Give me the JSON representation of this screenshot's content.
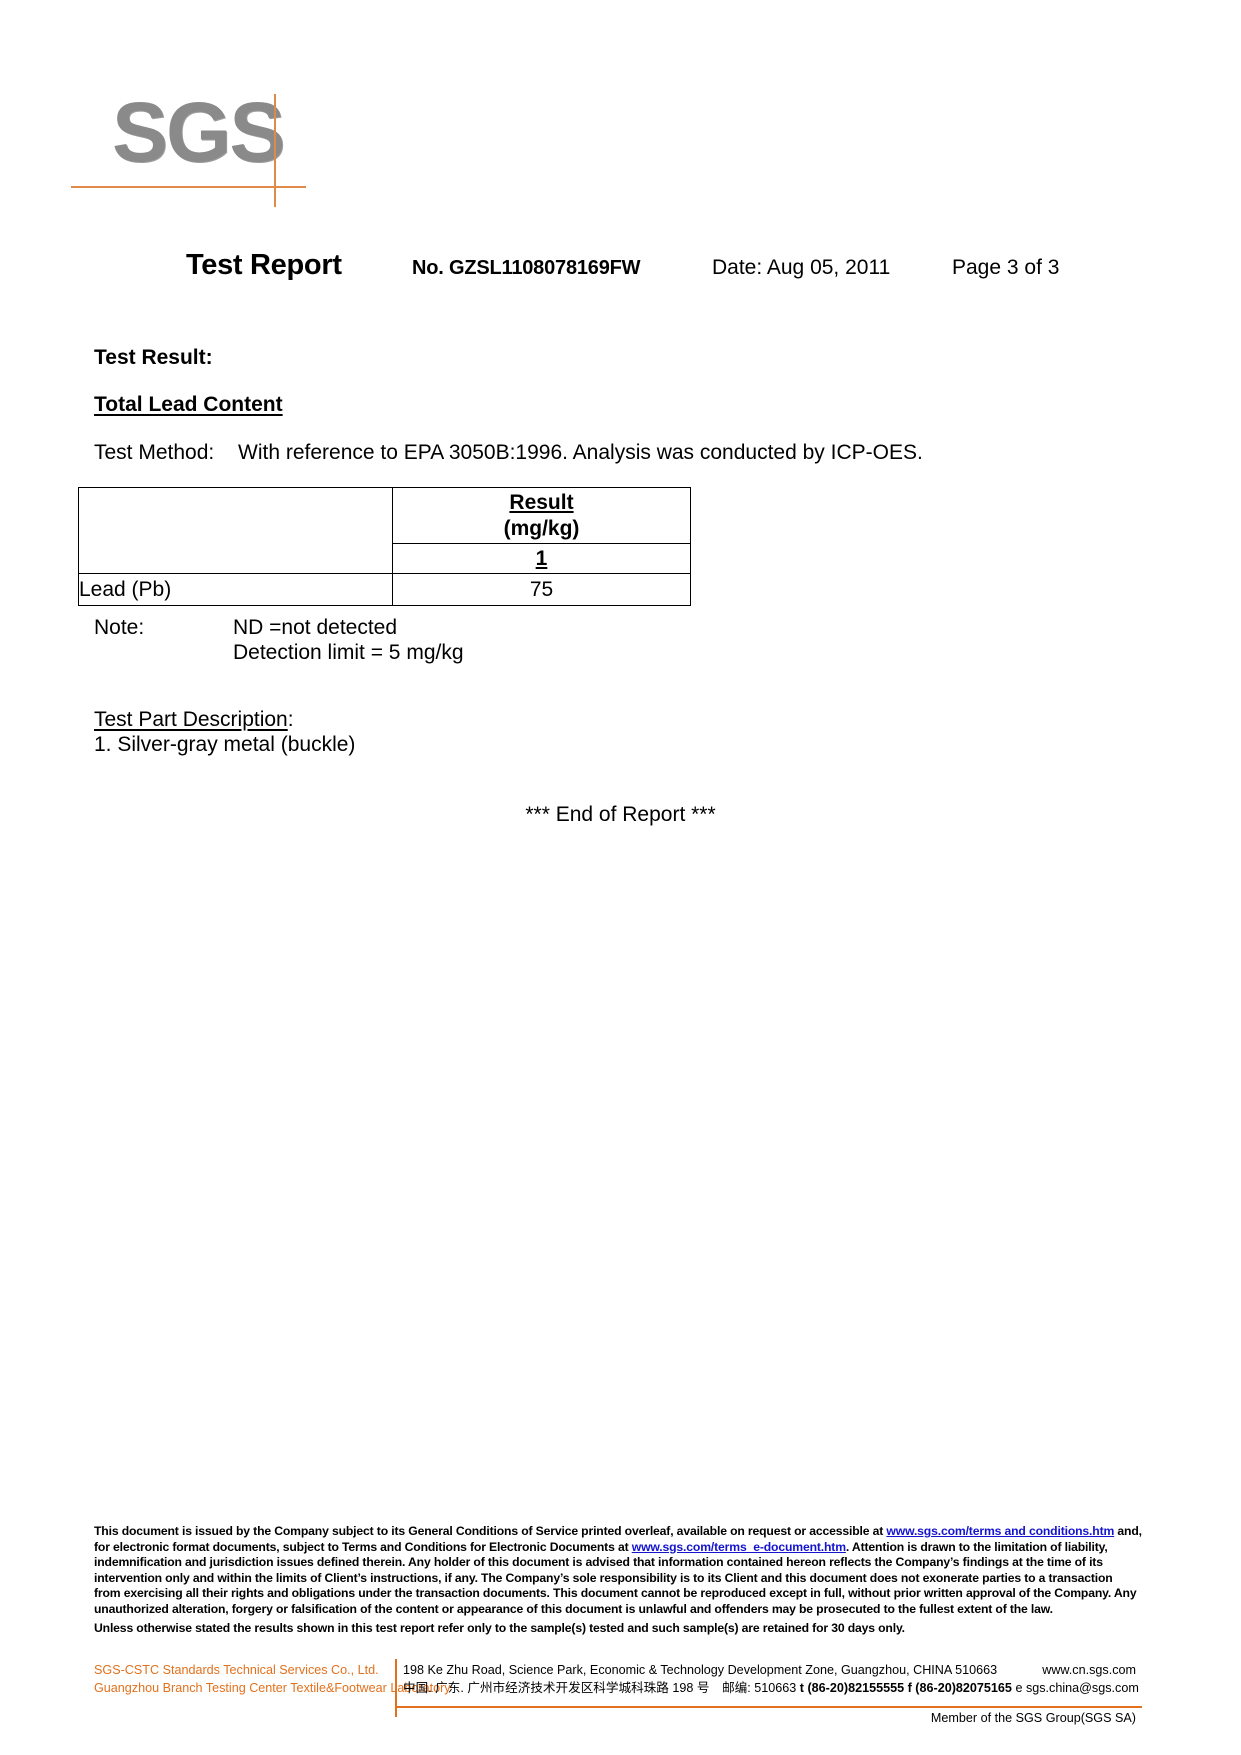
{
  "logo": {
    "text": "SGS",
    "accent_color": "#e08a4a",
    "text_color": "#8a8a8a"
  },
  "header": {
    "title": "Test Report",
    "report_no": "No. GZSL1108078169FW",
    "date": "Date: Aug 05, 2011",
    "page": "Page 3 of 3"
  },
  "body": {
    "test_result_heading": "Test Result:",
    "section_heading": "Total Lead Content",
    "test_method_label": "Test Method:",
    "test_method_value": "With reference to EPA 3050B:1996. Analysis was conducted by ICP-OES.",
    "note_label": "Note:",
    "note_line_1": "ND =not detected",
    "note_line_2": "Detection limit = 5 mg/kg",
    "tpd_heading_underlined": "Test Part Description",
    "tpd_heading_colon": ":",
    "tpd_item_1": "1. Silver-gray metal (buckle)",
    "end_of_report": "*** End of Report ***"
  },
  "results_table": {
    "header_blank": "",
    "header_result_line1": "Result",
    "header_result_line2": "(mg/kg)",
    "sub_blank": "",
    "sub_index": "1",
    "rows": [
      {
        "label": "Lead (Pb)",
        "value": "75"
      }
    ]
  },
  "footer": {
    "legal_p1_a": "This document is issued by the Company subject to its General Conditions of  Service printed overleaf, available on request or accessible at ",
    "legal_link_1": "www.sgs.com/terms and conditions.htm",
    "legal_p1_b": " and, for electronic format documents, subject to Terms and Conditions for Electronic Documents at ",
    "legal_link_2": "www.sgs.com/terms_e-document.htm",
    "legal_p1_c": ". Attention is drawn to the limitation of liability, indemnification and jurisdiction issues defined therein. Any holder of this document is advised that information contained hereon reflects the Company’s findings at the time of its intervention only and within the limits of Client’s instructions, if any. The Company’s sole responsibility is to its Client and this document does not exonerate parties to a transaction from exercising all their rights and obligations under the transaction documents. This document cannot be reproduced except in full, without prior written approval of the Company. Any unauthorized alteration, forgery or falsification of the content or appearance of this document is unlawful and offenders may be prosecuted to the fullest extent of the law.",
    "legal_p2": "Unless otherwise stated the results shown in this test report refer only to the sample(s) tested and such sample(s) are retained for 30 days only.",
    "company_line_1": "SGS-CSTC Standards Technical Services Co., Ltd.",
    "company_line_2": "Guangzhou Branch Testing Center Textile&Footwear Laboratory",
    "address_en": "198 Ke Zhu Road, Science Park, Economic & Technology Development Zone, Guangzhou, CHINA   510663",
    "website": "www.cn.sgs.com",
    "address_cn": "中国. 广东. 广州市经济技术开发区科学城科珠路 198 号　邮编: 510663",
    "tel": "t (86-20)82155555",
    "fax": "f (86-20)82075165",
    "email": "e sgs.china@sgs.com",
    "member_note": "Member of the SGS Group(SGS SA)",
    "accent_color": "#e2711d",
    "link_color": "#1414cf"
  }
}
